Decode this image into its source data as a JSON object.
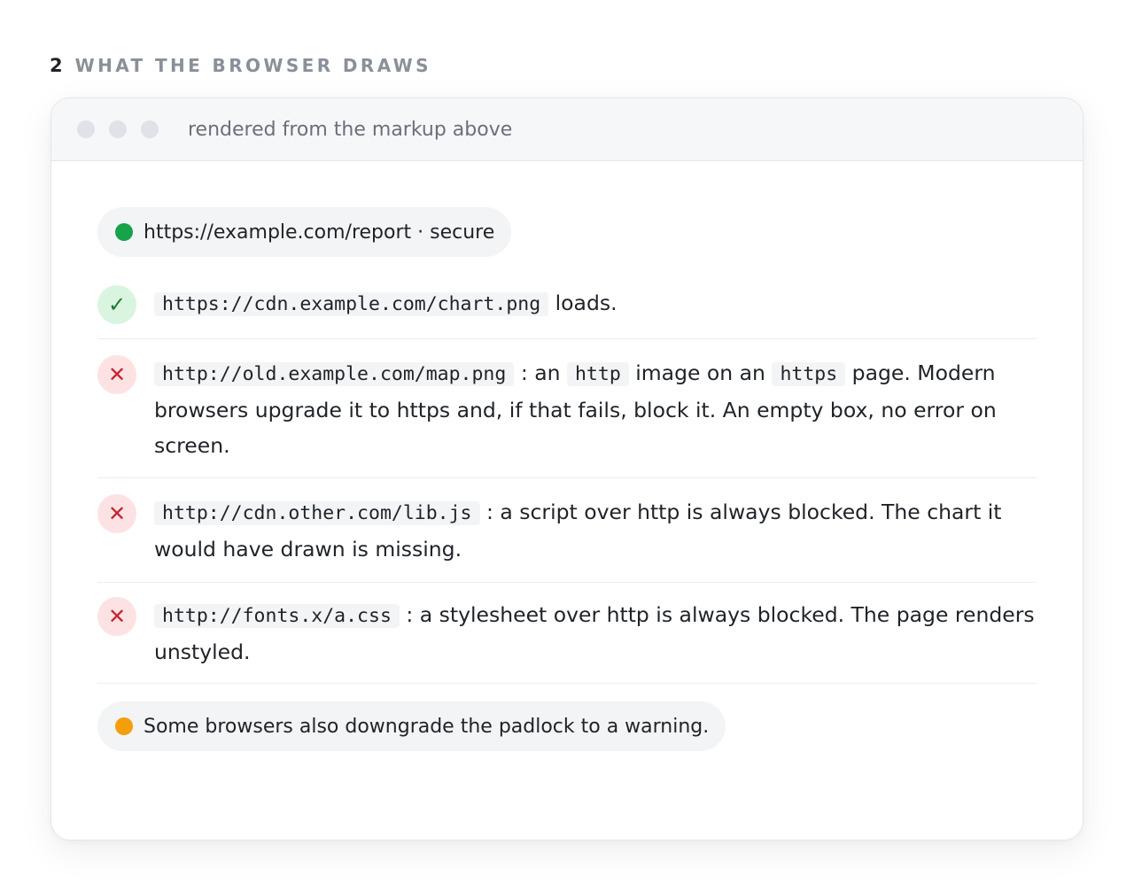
{
  "section": {
    "number": "2",
    "title": "WHAT THE BROWSER DRAWS"
  },
  "window": {
    "caption": "rendered from the markup above"
  },
  "address": {
    "text": "https://example.com/report · secure",
    "status_color": "#16a34a"
  },
  "resources": [
    {
      "status": "check-icon",
      "url": "https://cdn.example.com/chart.png",
      "text": "loads."
    },
    {
      "status": "cross-icon",
      "url": "http://old.example.com/map.png",
      "text_a": ": an",
      "code_a": "http",
      "text_b": "image on an",
      "code_b": "https",
      "text_c": "page. Modern browsers upgrade it to https and, if that fails, block it. An empty box, no error on screen."
    },
    {
      "status": "cross-icon",
      "url": "http://cdn.other.com/lib.js",
      "text": ": a script over http is always blocked. The chart it would have drawn is missing."
    },
    {
      "status": "cross-icon",
      "url": "http://fonts.x/a.css",
      "text": ": a stylesheet over http is always blocked. The page renders unstyled."
    }
  ],
  "warning": {
    "text": "Some browsers also downgrade the padlock to a warning.",
    "status_color": "#f59e0b"
  }
}
